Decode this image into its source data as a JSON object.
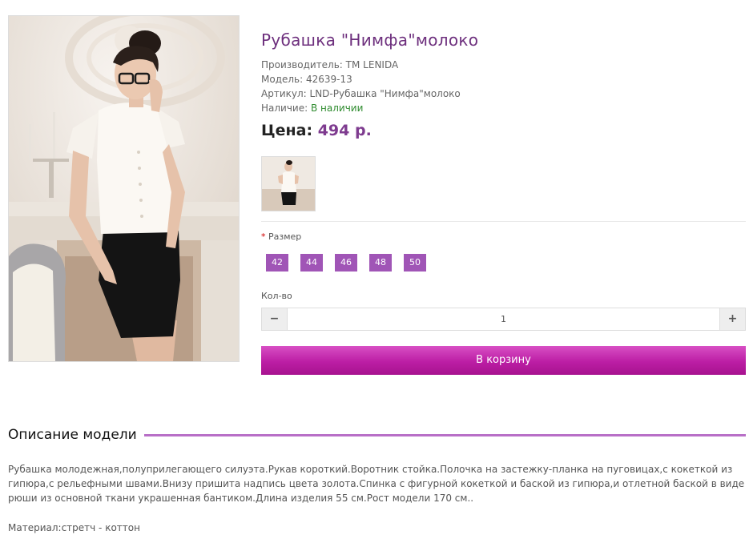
{
  "product": {
    "title": "Рубашка \"Нимфа\"молоко",
    "manufacturer_label": "Производитель:",
    "manufacturer": "TM LENIDA",
    "model_label": "Модель:",
    "model": "42639-13",
    "sku_label": "Артикул:",
    "sku": "LND-Рубашка \"Нимфа\"молоко",
    "availability_label": "Наличие:",
    "availability": "В наличии",
    "price_label": "Цена:",
    "price": "494 р."
  },
  "options": {
    "required_mark": "*",
    "size_label": "Размер",
    "sizes": [
      "42",
      "44",
      "46",
      "48",
      "50"
    ]
  },
  "quantity": {
    "label": "Кол-во",
    "minus": "−",
    "plus": "+",
    "value": "1"
  },
  "cart": {
    "button_label": "В корзину"
  },
  "description": {
    "heading": "Описание модели",
    "text": "Рубашка молодежная,полуприлегающего силуэта.Рукав короткий.Воротник стойка.Полочка на застежку-планка на пуговицах,с кокеткой из гипюра,с рельефными швами.Внизу пришита надпись цвета золота.Спинка с фигурной кокеткой и баской из гипюра,и отлетной баской в виде рюши из основной ткани украшенная бантиком.Длина изделия 55 см.Рост модели 170 см..",
    "material": "Материал:стретч - коттон"
  },
  "colors": {
    "title": "#6d2f7d",
    "price": "#7e3b8f",
    "size_button": "#a055b6",
    "cart_button": "#bc1ea5",
    "in_stock": "#2e8b2e",
    "accent_line": "#b86fc7"
  },
  "icons": {
    "minus": "minus-icon",
    "plus": "plus-icon"
  }
}
